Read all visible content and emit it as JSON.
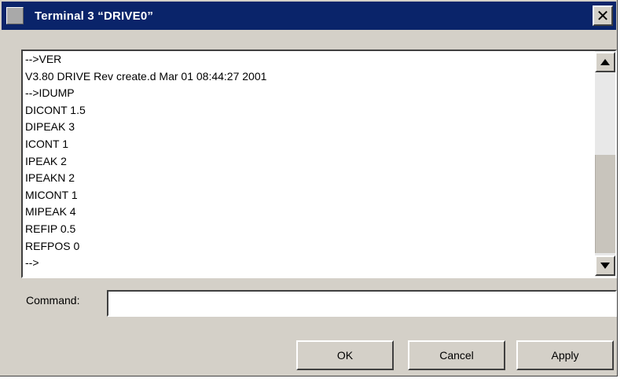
{
  "window": {
    "title": "Terminal 3 “DRIVE0”",
    "close_glyph": "✕"
  },
  "output": {
    "lines": [
      "-->VER",
      "V3.80 DRIVE Rev create.d Mar 01 08:44:27 2001",
      "-->IDUMP",
      "DICONT 1.5",
      "DIPEAK 3",
      "ICONT 1",
      "IPEAK 2",
      "IPEAKN 2",
      "MICONT 1",
      "MIPEAK 4",
      "REFIP 0.5",
      "REFPOS 0",
      "-->"
    ]
  },
  "command": {
    "label": "Command:",
    "value": "",
    "placeholder": ""
  },
  "buttons": {
    "ok": "OK",
    "cancel": "Cancel",
    "apply": "Apply"
  },
  "colors": {
    "titlebar": "#0a246a",
    "face": "#d4d0c8"
  }
}
